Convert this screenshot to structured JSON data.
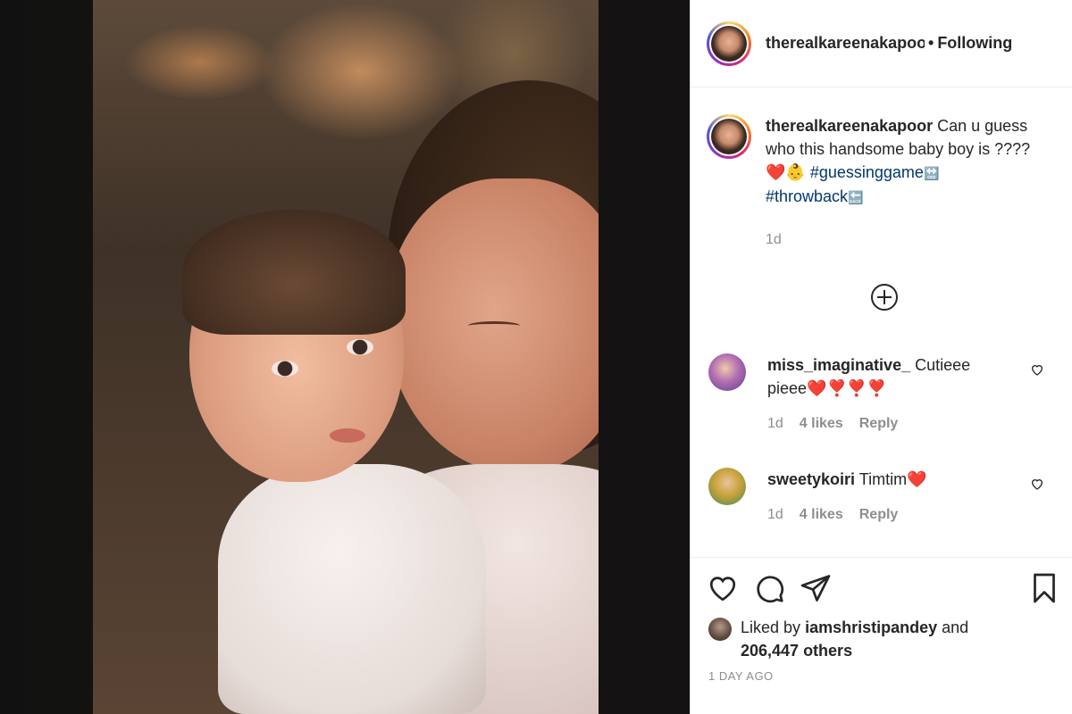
{
  "post": {
    "image_alt": "Photo of a mother kissing a baby boy",
    "header": {
      "username": "therealkareenakapoor",
      "separator": "•",
      "follow_status": "Following"
    },
    "caption": {
      "username": "therealkareenakapoor",
      "text": "Can u guess who this handsome baby boy is ????",
      "emoji": "❤️👶",
      "hashtag1": "#guessinggame",
      "hashtag1_emoji": "🔛",
      "hashtag2": "#throwback",
      "hashtag2_emoji": "🔙",
      "time": "1d"
    },
    "load_more_icon": "plus-circle-icon",
    "comments": [
      {
        "username": "miss_imaginative_",
        "text": "Cutieee pieee❤️❣️❣️❣️",
        "time": "1d",
        "likes": "4 likes",
        "reply": "Reply"
      },
      {
        "username": "sweetykoiri",
        "text": "Timtim❤️",
        "time": "1d",
        "likes": "4 likes",
        "reply": "Reply"
      }
    ],
    "actions": {
      "icons": [
        "heart-icon",
        "comment-icon",
        "share-icon",
        "bookmark-icon"
      ]
    },
    "likes": {
      "prefix": "Liked by",
      "user": "iamshristipandey",
      "connector": "and",
      "others": "206,447 others"
    },
    "date": "1 DAY AGO"
  },
  "colors": {
    "text": "#262626",
    "muted": "#8e8e8e",
    "hashtag": "#00376b",
    "heart": "#e0202c"
  }
}
